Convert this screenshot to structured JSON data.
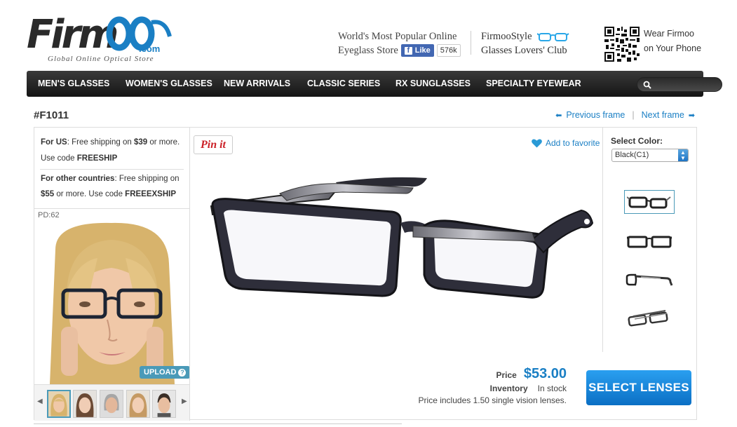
{
  "header": {
    "logo_tag": "Global Online Optical Store",
    "logo_com": ".com",
    "logo_word": "Firm",
    "slogan_line1": "World's Most Popular Online",
    "slogan_line2": "Eyeglass Store",
    "fb_like": "Like",
    "fb_count": "576k",
    "club_line1": "FirmooStyle",
    "club_line2": "Glasses Lovers' Club",
    "wear_line1": "Wear Firmoo",
    "wear_line2": "on Your Phone"
  },
  "nav": {
    "items": [
      "MEN'S GLASSES",
      "WOMEN'S GLASSES",
      "NEW ARRIVALS",
      "CLASSIC SERIES",
      "RX SUNGLASSES",
      "SPECIALTY EYEWEAR"
    ],
    "search_placeholder": ""
  },
  "product": {
    "sku": "#F1011",
    "prev": "Previous frame",
    "next": "Next frame",
    "sep": "|",
    "pinit": "Pin it",
    "favorite": "Add to favorite",
    "color_label": "Select Color:",
    "color_value": "Black(C1)",
    "price_label": "Price",
    "price": "$53.00",
    "inventory_label": "Inventory",
    "inventory": "In stock",
    "price_note": "Price includes 1.50 single vision lenses.",
    "select_button": "SELECT LENSES"
  },
  "shipping": {
    "us_label": "For US",
    "us_text1": ": Free shipping on ",
    "us_amount": "$39",
    "us_text2": " or more.",
    "us_code_text": "Use code ",
    "us_code": "FREESHIP",
    "other_label": "For other countries",
    "other_text1": ": Free shipping on",
    "other_amount": "$55",
    "other_text2": " or more. Use code ",
    "other_code": "FREEEXSHIP"
  },
  "tryon": {
    "pd": "PD:62",
    "upload": "UPLOAD",
    "help": "?"
  },
  "colors": {
    "accent": "#1a7fc4",
    "nav_bg": "#1e1e1e",
    "button": "#1a8ae0"
  }
}
